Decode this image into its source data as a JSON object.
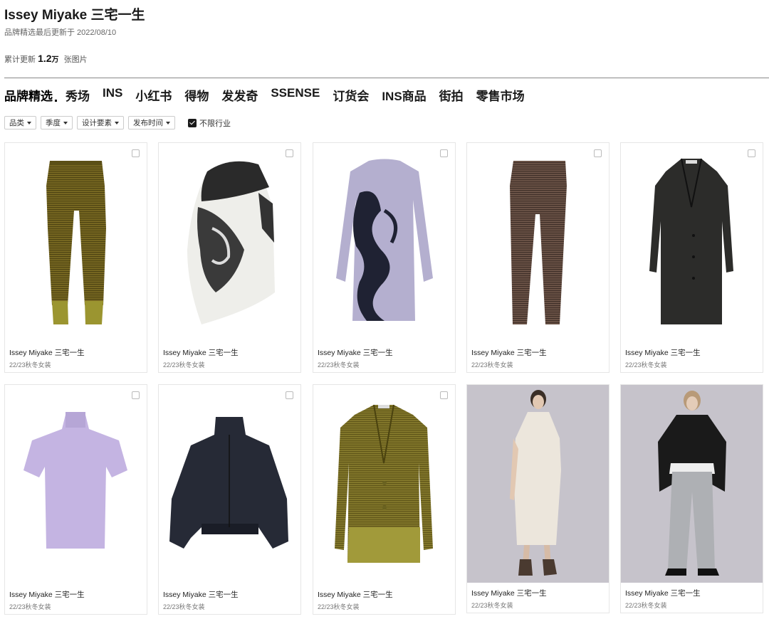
{
  "header": {
    "title": "Issey Miyake 三宅一生",
    "updated": "品牌精选最后更新于 2022/08/10",
    "total_prefix": "累计更新",
    "total_num": "1.2",
    "total_unit": "万",
    "total_suffix": "张图片"
  },
  "tabs": [
    {
      "label": "品牌精选"
    },
    {
      "label": "秀场"
    },
    {
      "label": "INS"
    },
    {
      "label": "小红书"
    },
    {
      "label": "得物"
    },
    {
      "label": "发发奇"
    },
    {
      "label": "SSENSE"
    },
    {
      "label": "订货会"
    },
    {
      "label": "INS商品"
    },
    {
      "label": "街拍"
    },
    {
      "label": "零售市场"
    }
  ],
  "filters": {
    "category": "品类",
    "season": "季度",
    "design": "设计要素",
    "time": "发布时间",
    "unrestricted": "不限行业"
  },
  "items": [
    {
      "name": "Issey Miyake 三宅一生",
      "season": "22/23秋冬女装",
      "kind": "pants-olive"
    },
    {
      "name": "Issey Miyake 三宅一生",
      "season": "22/23秋冬女装",
      "kind": "skirt-print"
    },
    {
      "name": "Issey Miyake 三宅一生",
      "season": "22/23秋冬女装",
      "kind": "dress-lavender"
    },
    {
      "name": "Issey Miyake 三宅一生",
      "season": "22/23秋冬女装",
      "kind": "pants-brown"
    },
    {
      "name": "Issey Miyake 三宅一生",
      "season": "22/23秋冬女装",
      "kind": "coat-black"
    },
    {
      "name": "Issey Miyake 三宅一生",
      "season": "22/23秋冬女装",
      "kind": "top-lilac"
    },
    {
      "name": "Issey Miyake 三宅一生",
      "season": "22/23秋冬女装",
      "kind": "jacket-navy"
    },
    {
      "name": "Issey Miyake 三宅一生",
      "season": "22/23秋冬女装",
      "kind": "blazer-olive"
    },
    {
      "name": "Issey Miyake 三宅一生",
      "season": "22/23秋冬女装",
      "kind": "model-cream"
    },
    {
      "name": "Issey Miyake 三宅一生",
      "season": "22/23秋冬女装",
      "kind": "model-black"
    }
  ]
}
